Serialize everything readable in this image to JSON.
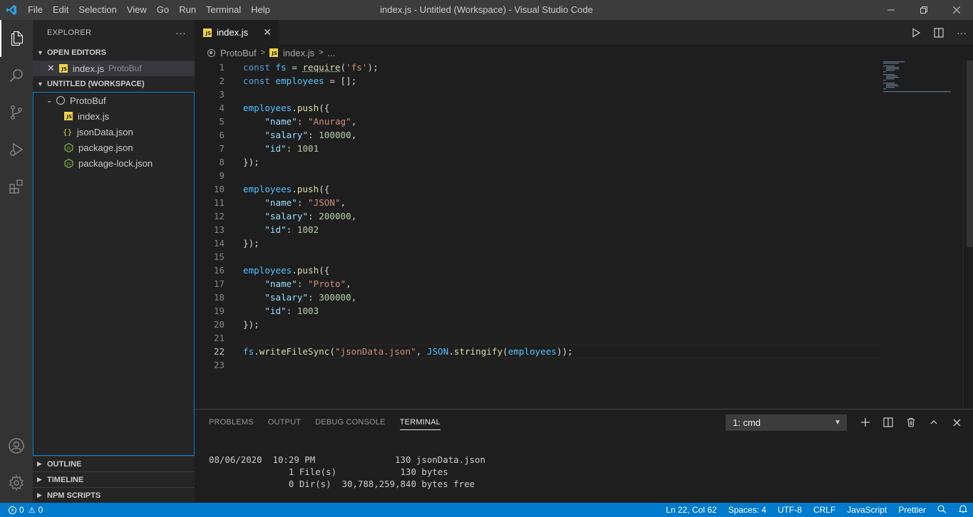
{
  "window": {
    "title": "index.js - Untitled (Workspace) - Visual Studio Code",
    "menu": [
      "File",
      "Edit",
      "Selection",
      "View",
      "Go",
      "Run",
      "Terminal",
      "Help"
    ]
  },
  "sidebar": {
    "title": "EXPLORER",
    "open_editors": {
      "label": "OPEN EDITORS",
      "items": [
        {
          "name": "index.js",
          "desc": "ProtoBuf"
        }
      ]
    },
    "workspace": {
      "label": "UNTITLED (WORKSPACE)",
      "folder": "ProtoBuf",
      "files": [
        "index.js",
        "jsonData.json",
        "package.json",
        "package-lock.json"
      ]
    },
    "outline": "OUTLINE",
    "timeline": "TIMELINE",
    "npm_scripts": "NPM SCRIPTS"
  },
  "editor": {
    "tab": "index.js",
    "breadcrumb": [
      "ProtoBuf",
      "index.js",
      "..."
    ],
    "current_line": 22,
    "lines": [
      "const fs = require('fs');",
      "const employees = [];",
      "",
      "employees.push({",
      "    \"name\": \"Anurag\",",
      "    \"salary\": 100000,",
      "    \"id\": 1001",
      "});",
      "",
      "employees.push({",
      "    \"name\": \"JSON\",",
      "    \"salary\": 200000,",
      "    \"id\": 1002",
      "});",
      "",
      "employees.push({",
      "    \"name\": \"Proto\",",
      "    \"salary\": 300000,",
      "    \"id\": 1003",
      "});",
      "",
      "fs.writeFileSync(\"jsonData.json\", JSON.stringify(employees));",
      ""
    ]
  },
  "panel": {
    "tabs": [
      "PROBLEMS",
      "OUTPUT",
      "DEBUG CONSOLE",
      "TERMINAL"
    ],
    "active_tab": "TERMINAL",
    "terminal_select": "1: cmd",
    "terminal_lines": [
      "08/06/2020  10:29 PM               130 jsonData.json",
      "               1 File(s)            130 bytes",
      "               0 Dir(s)  30,788,259,840 bytes free"
    ]
  },
  "statusbar": {
    "errors": "0",
    "warnings": "0",
    "position": "Ln 22, Col 62",
    "spaces": "Spaces: 4",
    "encoding": "UTF-8",
    "eol": "CRLF",
    "language": "JavaScript",
    "formatter": "Prettier"
  },
  "colors": {
    "statusbar": "#007acc",
    "activitybar": "#333333",
    "sidebar": "#252526",
    "editor": "#1e1e1e"
  }
}
